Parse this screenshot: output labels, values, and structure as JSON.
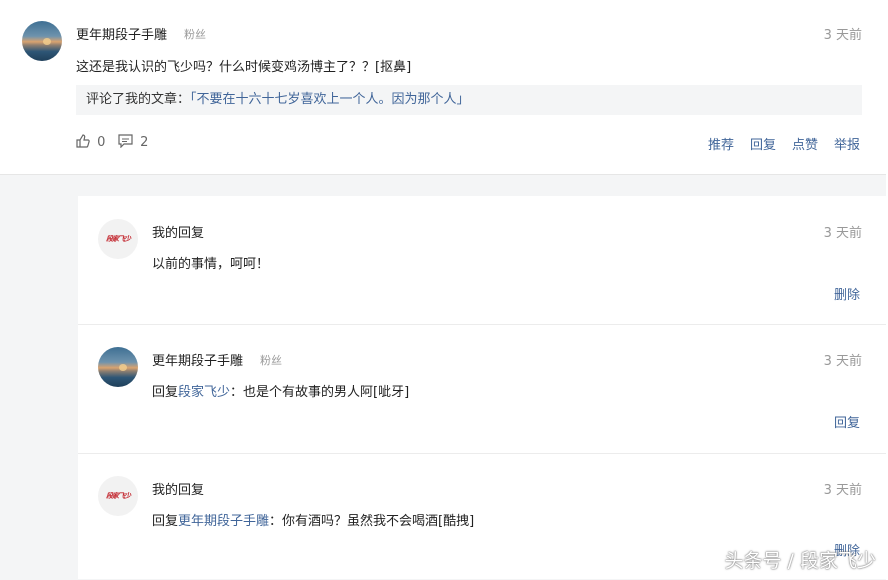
{
  "comment": {
    "author": "更年期段子手雕",
    "author_tag": "粉丝",
    "time": "3 天前",
    "text": "这还是我认识的飞少吗？什么时候变鸡汤博主了？？[抠鼻]",
    "quote_label": "评论了我的文章：",
    "quote_link": "「不要在十六十七岁喜欢上一个人。因为那个人」",
    "likes": "0",
    "replies_count": "2",
    "actions": {
      "recommend": "推荐",
      "reply": "回复",
      "like": "点赞",
      "report": "举报"
    }
  },
  "replies": [
    {
      "author": "我的回复",
      "time": "3 天前",
      "text": "以前的事情，呵呵！",
      "action": "删除",
      "logo_text": "段家飞少"
    },
    {
      "author": "更年期段子手雕",
      "author_tag": "粉丝",
      "time": "3 天前",
      "prefix": "回复",
      "mention": "段家飞少",
      "text": "：也是个有故事的男人阿[呲牙]",
      "action": "回复"
    },
    {
      "author": "我的回复",
      "time": "3 天前",
      "prefix": "回复",
      "mention": "更年期段子手雕",
      "text": "：你有酒吗？虽然我不会喝酒[酷拽]",
      "action": "删除",
      "logo_text": "段家飞少"
    }
  ],
  "watermark": "头条号 / 段家飞少"
}
